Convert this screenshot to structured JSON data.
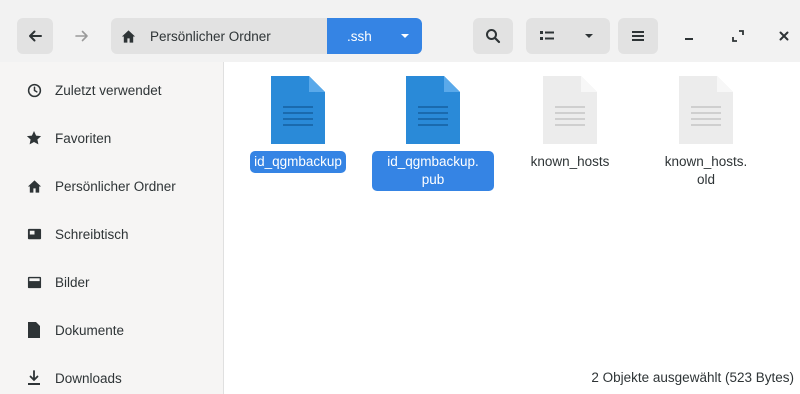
{
  "toolbar": {
    "back_icon": "arrow-left-icon",
    "forward_icon": "arrow-right-icon",
    "search_icon": "search-icon",
    "view_icon": "list-view-icon",
    "view_menu_icon": "chevron-down-icon",
    "main_menu_icon": "hamburger-menu-icon"
  },
  "pathbar": {
    "home_label": "Persönlicher Ordner",
    "current_label": ".ssh"
  },
  "window_controls": [
    "minimize-icon",
    "maximize-icon",
    "close-icon"
  ],
  "sidebar": {
    "items": [
      {
        "label": "Zuletzt verwendet",
        "icon": "clock-icon"
      },
      {
        "label": "Favoriten",
        "icon": "star-icon"
      },
      {
        "label": "Persönlicher Ordner",
        "icon": "home-icon"
      },
      {
        "label": "Schreibtisch",
        "icon": "desktop-icon"
      },
      {
        "label": "Bilder",
        "icon": "pictures-icon"
      },
      {
        "label": "Dokumente",
        "icon": "document-icon"
      },
      {
        "label": "Downloads",
        "icon": "download-icon"
      }
    ]
  },
  "files": [
    {
      "name": "id_qgmbackup",
      "selected": true,
      "icon": "text-file-icon"
    },
    {
      "name": "id_qgmbackup.\npub",
      "selected": true,
      "icon": "text-file-icon"
    },
    {
      "name": "known_hosts",
      "selected": false,
      "icon": "text-file-icon"
    },
    {
      "name": "known_hosts.\nold",
      "selected": false,
      "icon": "text-file-icon"
    }
  ],
  "status": "2 Objekte ausgewählt (523 Bytes)",
  "colors": {
    "accent": "#3584e4",
    "file_selected": "#2a8ad8",
    "file_unselected": "#ececec"
  }
}
